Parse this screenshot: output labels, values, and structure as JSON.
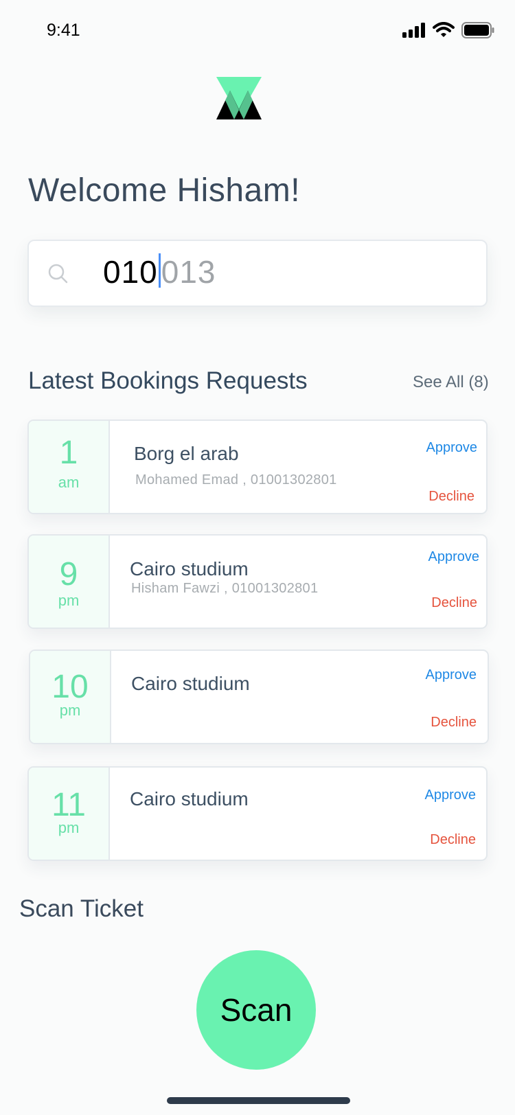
{
  "status_bar": {
    "time": "9:41"
  },
  "welcome": "Welcome Hisham!",
  "search": {
    "typed": "010",
    "suggestion": "013"
  },
  "bookings": {
    "title": "Latest Bookings Requests",
    "see_all": "See All (8)",
    "items": [
      {
        "hour": "1",
        "period": "am",
        "venue": "Borg el arab",
        "person": "Mohamed Emad , 01001302801",
        "approve": "Approve",
        "decline": "Decline"
      },
      {
        "hour": "9",
        "period": "pm",
        "venue": "Cairo studium",
        "person": "Hisham Fawzi , 01001302801",
        "approve": "Approve",
        "decline": "Decline"
      },
      {
        "hour": "10",
        "period": "pm",
        "venue": "Cairo studium",
        "person": "",
        "approve": "Approve",
        "decline": "Decline"
      },
      {
        "hour": "11",
        "period": "pm",
        "venue": "Cairo studium",
        "person": "",
        "approve": "Approve",
        "decline": "Decline"
      }
    ]
  },
  "scan": {
    "title": "Scan Ticket",
    "button": "Scan"
  },
  "colors": {
    "accent": "#69f2b0",
    "approve": "#1e88e5",
    "decline": "#e5533d",
    "heading": "#34495e"
  },
  "icons": [
    "signal-icon",
    "wifi-icon",
    "battery-icon",
    "app-logo",
    "search-icon"
  ]
}
